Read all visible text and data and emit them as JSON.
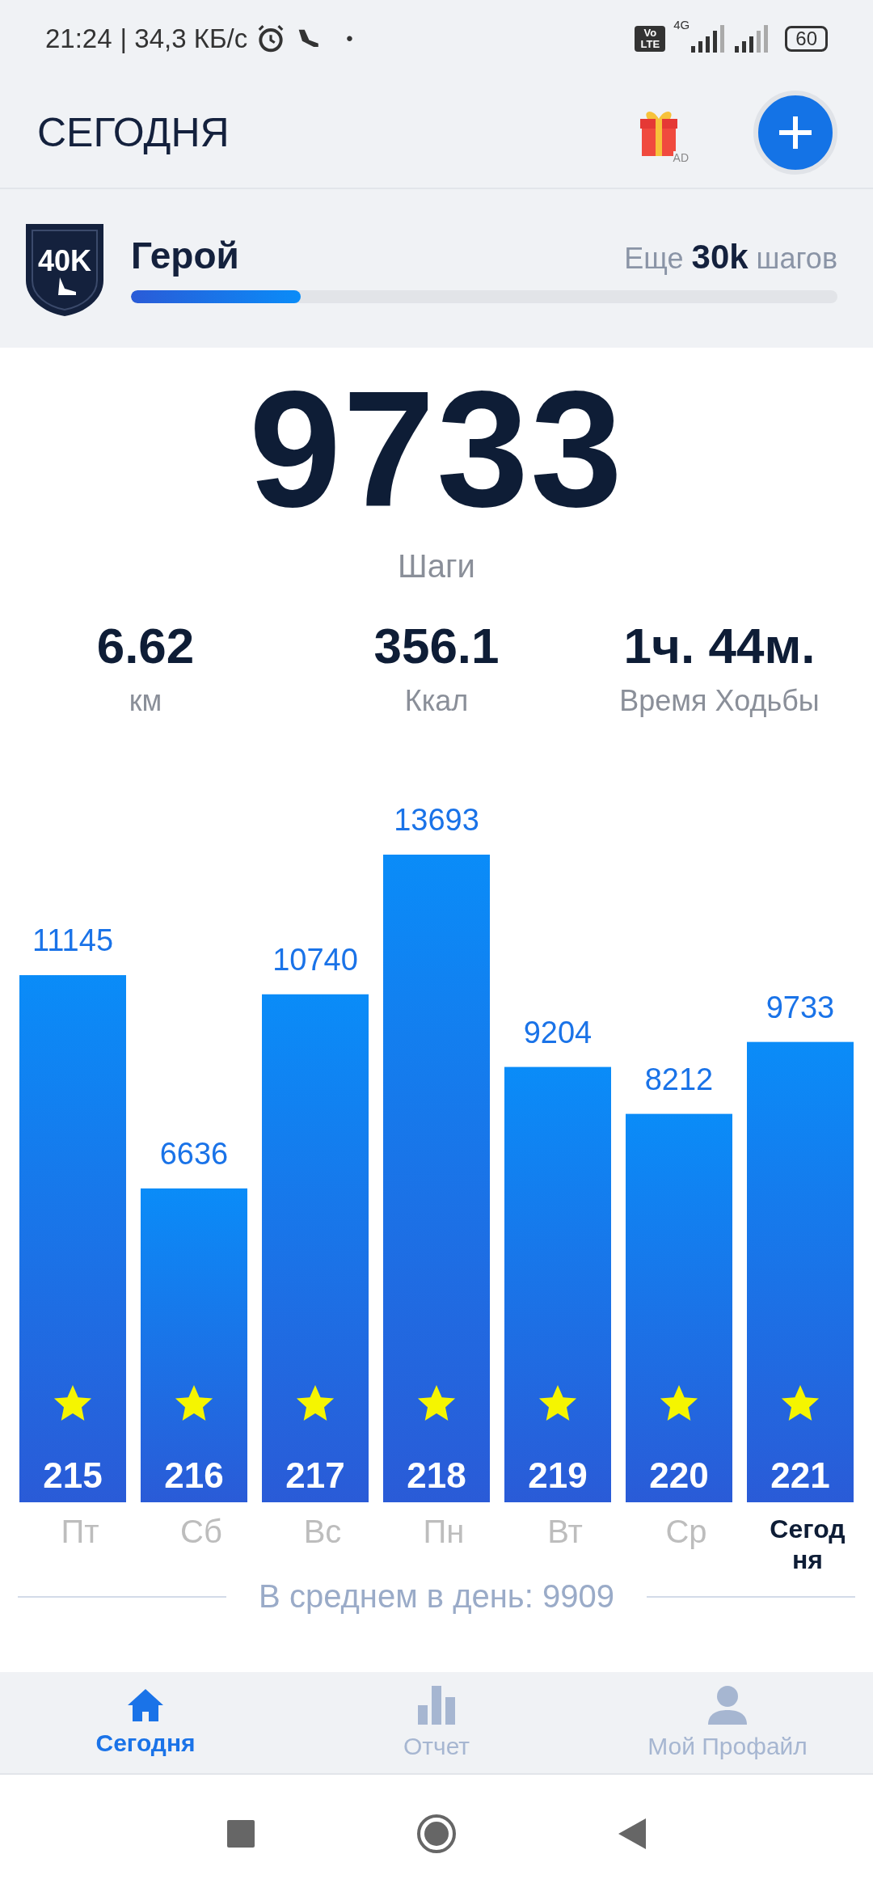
{
  "status_bar": {
    "time": "21:24",
    "speed": "| 34,3 КБ/с",
    "dot": "•",
    "network": "4G",
    "volte": "Vo LTE",
    "battery": "60"
  },
  "header": {
    "title": "СЕГОДНЯ",
    "ad_label": "AD"
  },
  "goal": {
    "badge": "40K",
    "name": "Герой",
    "remaining": "Еще **30k** шагов",
    "level": 0.24
  },
  "steps": {
    "value": "9733",
    "label": "Шаги"
  },
  "stats": [
    {
      "value": "6.62",
      "label": "км"
    },
    {
      "value": "356.1",
      "label": "Ккал"
    },
    {
      "value": "1ч. 44м.",
      "label": "Время Ходьбы"
    }
  ],
  "week": {
    "chart_data": {
      "type": "bar",
      "categories": [
        "Пт",
        "Сб",
        "Вс",
        "Пн",
        "Вт",
        "Ср",
        "Сегодня"
      ],
      "values": [
        11145,
        6636,
        10740,
        13693,
        9204,
        8212,
        9733
      ],
      "data_labels": true
    },
    "day_selected": [
      false,
      false,
      false,
      false,
      false,
      false,
      true
    ],
    "counts": [
      "215",
      "216",
      "217",
      "218",
      "219",
      "220",
      "221"
    ],
    "average": "В среднем в день: 9909"
  },
  "bottom_nav": [
    {
      "label": "Сегодня",
      "selected": true
    },
    {
      "label": "Отчет",
      "selected": false
    },
    {
      "label": "Мой Профайл",
      "selected": false
    }
  ]
}
